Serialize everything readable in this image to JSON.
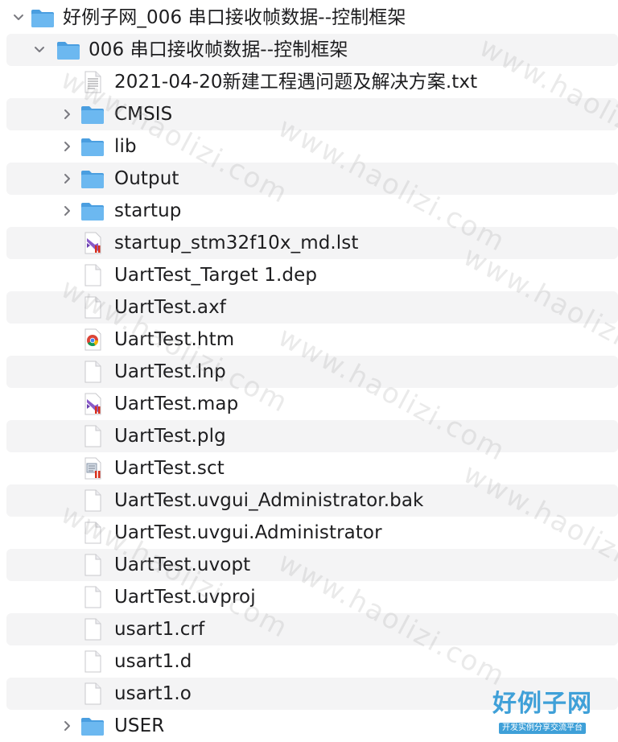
{
  "rows": [
    {
      "label": "好例子网_006 串口接收帧数据--控制框架",
      "level": 0,
      "icon": "folder-icon",
      "expander": "expanded"
    },
    {
      "label": "006 串口接收帧数据--控制框架",
      "level": 1,
      "icon": "folder-icon",
      "expander": "expanded"
    },
    {
      "label": "2021-04-20新建工程遇问题及解决方案.txt",
      "level": 2,
      "icon": "text-file-icon",
      "expander": "none"
    },
    {
      "label": "CMSIS",
      "level": 2,
      "icon": "folder-icon",
      "expander": "collapsed"
    },
    {
      "label": "lib",
      "level": 2,
      "icon": "folder-icon",
      "expander": "collapsed"
    },
    {
      "label": "Output",
      "level": 2,
      "icon": "folder-icon",
      "expander": "collapsed"
    },
    {
      "label": "startup",
      "level": 2,
      "icon": "folder-icon",
      "expander": "collapsed"
    },
    {
      "label": "startup_stm32f10x_md.lst",
      "level": 2,
      "icon": "visual-studio-file-icon",
      "expander": "none"
    },
    {
      "label": "UartTest_Target 1.dep",
      "level": 2,
      "icon": "blank-file-icon",
      "expander": "none"
    },
    {
      "label": "UartTest.axf",
      "level": 2,
      "icon": "blank-file-icon",
      "expander": "none"
    },
    {
      "label": "UartTest.htm",
      "level": 2,
      "icon": "chrome-file-icon",
      "expander": "none"
    },
    {
      "label": "UartTest.lnp",
      "level": 2,
      "icon": "blank-file-icon",
      "expander": "none"
    },
    {
      "label": "UartTest.map",
      "level": 2,
      "icon": "visual-studio-file-icon",
      "expander": "none"
    },
    {
      "label": "UartTest.plg",
      "level": 2,
      "icon": "blank-file-icon",
      "expander": "none"
    },
    {
      "label": "UartTest.sct",
      "level": 2,
      "icon": "script-file-icon",
      "expander": "none"
    },
    {
      "label": "UartTest.uvgui_Administrator.bak",
      "level": 2,
      "icon": "blank-file-icon",
      "expander": "none"
    },
    {
      "label": "UartTest.uvgui.Administrator",
      "level": 2,
      "icon": "blank-file-icon",
      "expander": "none"
    },
    {
      "label": "UartTest.uvopt",
      "level": 2,
      "icon": "blank-file-icon",
      "expander": "none"
    },
    {
      "label": "UartTest.uvproj",
      "level": 2,
      "icon": "blank-file-icon",
      "expander": "none"
    },
    {
      "label": "usart1.crf",
      "level": 2,
      "icon": "blank-file-icon",
      "expander": "none"
    },
    {
      "label": "usart1.d",
      "level": 2,
      "icon": "blank-file-icon",
      "expander": "none"
    },
    {
      "label": "usart1.o",
      "level": 2,
      "icon": "blank-file-icon",
      "expander": "none"
    },
    {
      "label": "USER",
      "level": 2,
      "icon": "folder-icon",
      "expander": "collapsed"
    }
  ],
  "watermark": "www.haolizi.com",
  "logo": {
    "title": "好例子网",
    "subtitle": "开发实例分享交流平台"
  },
  "colors": {
    "folder": "#5aa9e6",
    "stripe": "#f4f4f5",
    "logo": "#3fa0d8"
  }
}
